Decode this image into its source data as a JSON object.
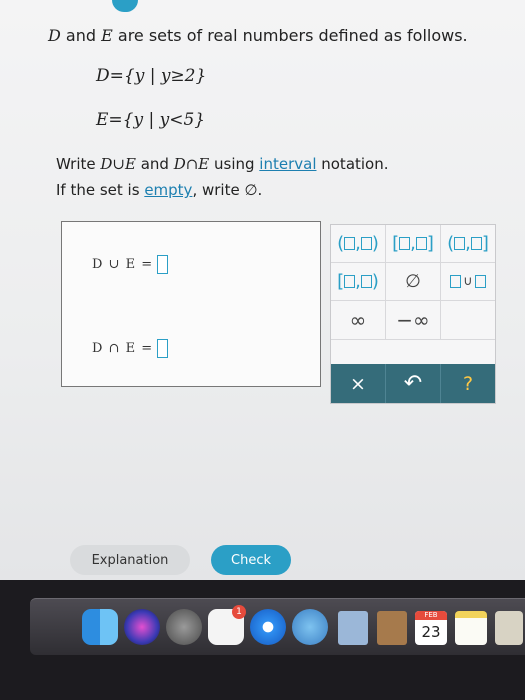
{
  "problem": {
    "prompt_var1": "D",
    "prompt_and": " and ",
    "prompt_var2": "E",
    "prompt_rest": " are sets of real numbers defined as follows.",
    "set_d": "D={y | y≥2}",
    "set_e": "E={y | y<5}",
    "instruction_lead": "Write ",
    "instruction_expr1": "D∪E",
    "instruction_mid": " and ",
    "instruction_expr2": "D∩E",
    "instruction_using": " using ",
    "instruction_link": "interval",
    "instruction_end": " notation.",
    "empty_lead": "If the set is ",
    "empty_link": "empty",
    "empty_end": ", write ∅."
  },
  "answers": {
    "union_label": "D ∪ E =",
    "intersection_label": "D ∩ E ="
  },
  "keypad": {
    "infinity": "∞",
    "neg_infinity": "−∞",
    "empty_set": "∅",
    "clear": "×",
    "undo": "↶",
    "help": "?"
  },
  "buttons": {
    "explanation": "Explanation",
    "check": "Check"
  },
  "dock": {
    "notification_badge": "1",
    "calendar_month": "FEB",
    "calendar_day": "23"
  },
  "colors": {
    "accent": "#2b9fc6",
    "keypad_bar": "#356c7a",
    "help_icon": "#ffc844"
  }
}
